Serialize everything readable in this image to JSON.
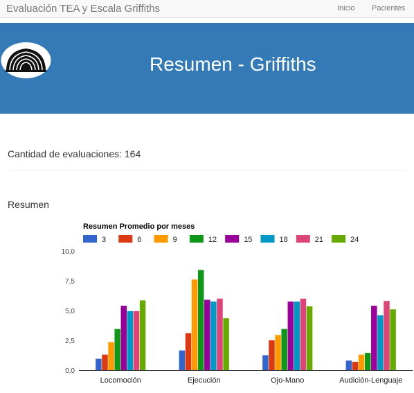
{
  "navbar": {
    "brand": "Evaluación TEA y Escala Griffiths",
    "links": [
      "Inicio",
      "Pacientes"
    ]
  },
  "banner": {
    "title": "Resumen - Griffiths",
    "logo_icon": "university-logo-icon",
    "background": "#337ab7"
  },
  "content": {
    "count_text": "Cantidad de evaluaciones: 164",
    "section_title": "Resumen"
  },
  "chart_data": {
    "type": "bar",
    "title": "Resumen Promedio por meses",
    "categories": [
      "Locomoción",
      "Ejecución",
      "Ojo-Mano",
      "Audición-Lenguaje"
    ],
    "ylim": [
      0,
      10
    ],
    "yticks": [
      "0,0",
      "2,5",
      "5,0",
      "7,5",
      "10,0"
    ],
    "grid": false,
    "legend_position": "top",
    "series": [
      {
        "name": "3",
        "color": "#3366cc",
        "values": [
          0.95,
          1.65,
          1.25,
          0.8
        ]
      },
      {
        "name": "6",
        "color": "#dc3912",
        "values": [
          1.3,
          3.1,
          2.5,
          0.7
        ]
      },
      {
        "name": "9",
        "color": "#ff9900",
        "values": [
          2.35,
          7.6,
          2.95,
          1.3
        ]
      },
      {
        "name": "12",
        "color": "#109618",
        "values": [
          3.45,
          8.4,
          3.45,
          1.45
        ]
      },
      {
        "name": "15",
        "color": "#990099",
        "values": [
          5.4,
          5.9,
          5.75,
          5.4
        ]
      },
      {
        "name": "18",
        "color": "#0099c6",
        "values": [
          4.95,
          5.75,
          5.75,
          4.6
        ]
      },
      {
        "name": "21",
        "color": "#dd4477",
        "values": [
          4.95,
          6.0,
          6.0,
          5.8
        ]
      },
      {
        "name": "24",
        "color": "#66aa00",
        "values": [
          5.85,
          4.35,
          5.35,
          5.1
        ]
      }
    ]
  }
}
